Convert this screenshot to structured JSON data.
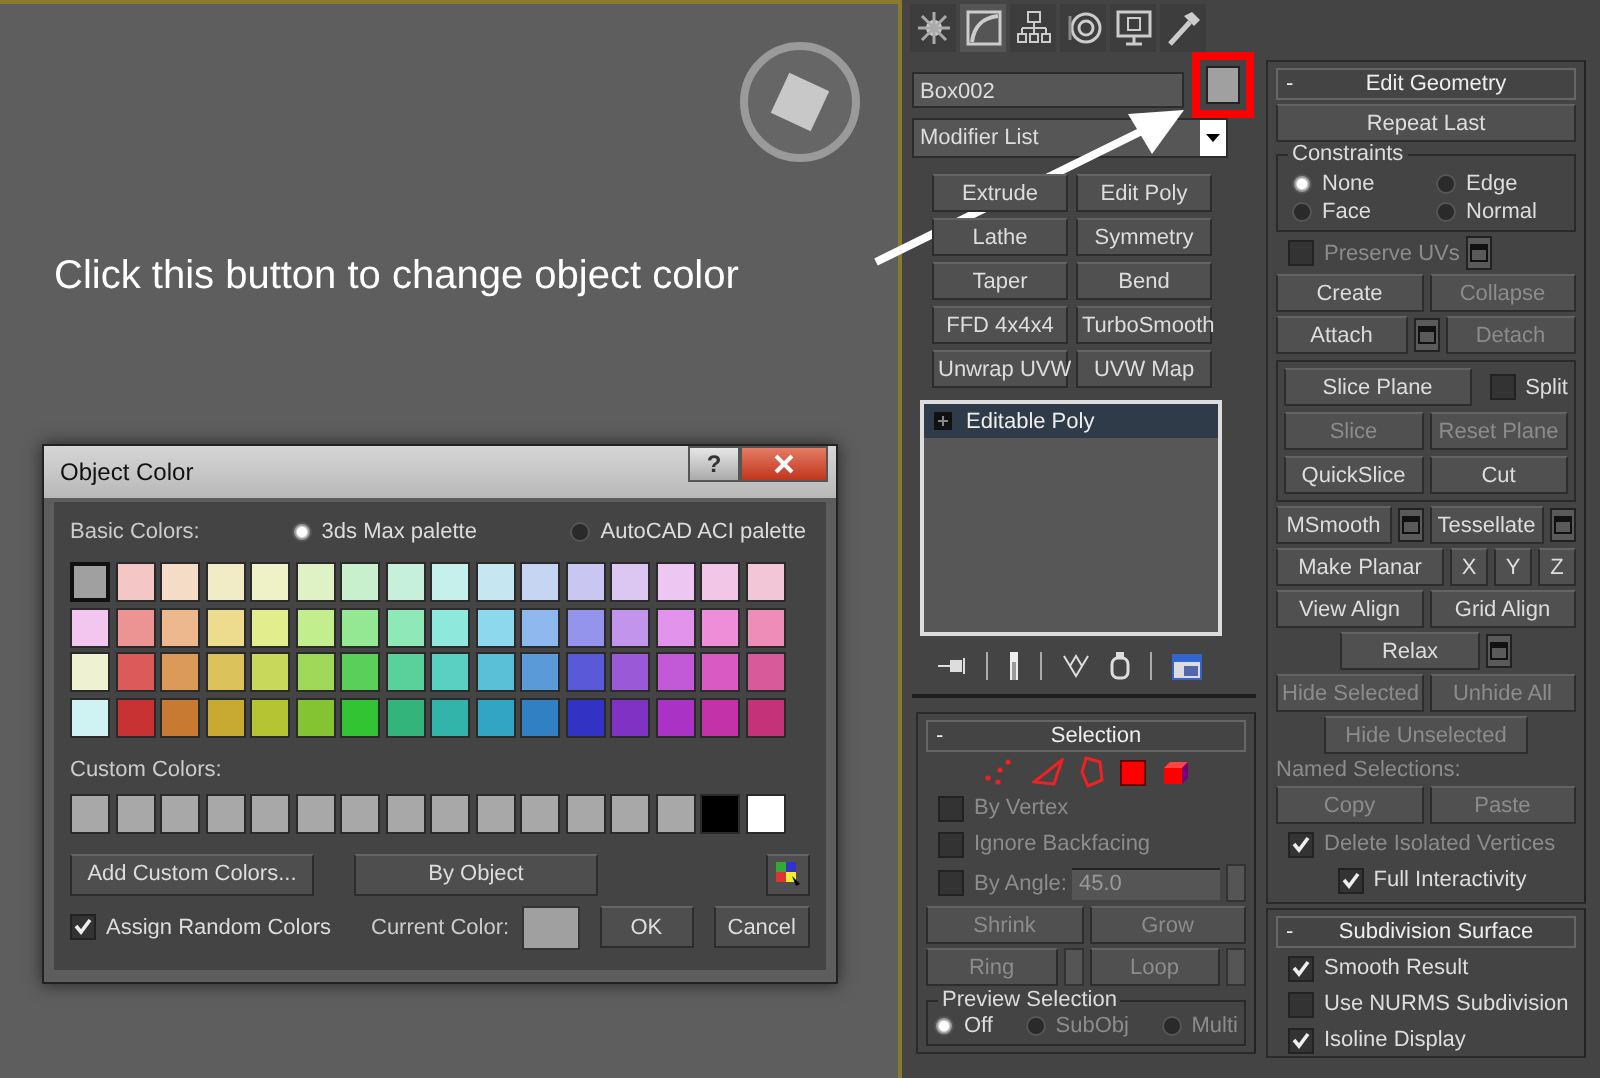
{
  "viewport": {
    "annotation": "Click this button to change object color"
  },
  "dialog": {
    "title": "Object Color",
    "help_button": "?",
    "basic_colors_label": "Basic Colors:",
    "palettes": [
      {
        "label": "3ds Max palette",
        "selected": true
      },
      {
        "label": "AutoCAD ACI palette",
        "selected": false
      }
    ],
    "basic_colors": [
      {
        "color": "#a0a0a0",
        "selected": true
      },
      {
        "color": "#f4c6c6",
        "selected": false
      },
      {
        "color": "#f4dcc6",
        "selected": false
      },
      {
        "color": "#f2ecc6",
        "selected": false
      },
      {
        "color": "#eef2c6",
        "selected": false
      },
      {
        "color": "#dff2c6",
        "selected": false
      },
      {
        "color": "#c9f0cc",
        "selected": false
      },
      {
        "color": "#c6f0dc",
        "selected": false
      },
      {
        "color": "#c6f0ec",
        "selected": false
      },
      {
        "color": "#c6e6f2",
        "selected": false
      },
      {
        "color": "#c6d6f2",
        "selected": false
      },
      {
        "color": "#cac6f2",
        "selected": false
      },
      {
        "color": "#dcc6f2",
        "selected": false
      },
      {
        "color": "#eec6f2",
        "selected": false
      },
      {
        "color": "#f2c6e6",
        "selected": false
      },
      {
        "color": "#f2c6d6",
        "selected": false
      },
      {
        "color": "#f2c6ee",
        "selected": false
      },
      {
        "color": "#ec9494",
        "selected": false
      },
      {
        "color": "#eeb88e",
        "selected": false
      },
      {
        "color": "#eedc8e",
        "selected": false
      },
      {
        "color": "#e2ee8e",
        "selected": false
      },
      {
        "color": "#c2ee8e",
        "selected": false
      },
      {
        "color": "#94e894",
        "selected": false
      },
      {
        "color": "#8ee8b8",
        "selected": false
      },
      {
        "color": "#8ee8dc",
        "selected": false
      },
      {
        "color": "#8ed8ee",
        "selected": false
      },
      {
        "color": "#8eb8ee",
        "selected": false
      },
      {
        "color": "#9494ec",
        "selected": false
      },
      {
        "color": "#c294ec",
        "selected": false
      },
      {
        "color": "#e294ec",
        "selected": false
      },
      {
        "color": "#ee8ed8",
        "selected": false
      },
      {
        "color": "#ee8eb8",
        "selected": false
      },
      {
        "color": "#eef2d2",
        "selected": false
      },
      {
        "color": "#dc5a5a",
        "selected": false
      },
      {
        "color": "#dc9a5a",
        "selected": false
      },
      {
        "color": "#dcc25a",
        "selected": false
      },
      {
        "color": "#c8d85a",
        "selected": false
      },
      {
        "color": "#a0d85a",
        "selected": false
      },
      {
        "color": "#5ad05a",
        "selected": false
      },
      {
        "color": "#5ad09a",
        "selected": false
      },
      {
        "color": "#5ad0c2",
        "selected": false
      },
      {
        "color": "#5ac0d8",
        "selected": false
      },
      {
        "color": "#5a9ad8",
        "selected": false
      },
      {
        "color": "#5a5ad8",
        "selected": false
      },
      {
        "color": "#9a5ad8",
        "selected": false
      },
      {
        "color": "#c25ad8",
        "selected": false
      },
      {
        "color": "#d85ac2",
        "selected": false
      },
      {
        "color": "#d85a9a",
        "selected": false
      },
      {
        "color": "#cff2f2",
        "selected": false
      },
      {
        "color": "#c83232",
        "selected": false
      },
      {
        "color": "#c87a32",
        "selected": false
      },
      {
        "color": "#c8aa32",
        "selected": false
      },
      {
        "color": "#b4c432",
        "selected": false
      },
      {
        "color": "#84c432",
        "selected": false
      },
      {
        "color": "#32c432",
        "selected": false
      },
      {
        "color": "#32b47a",
        "selected": false
      },
      {
        "color": "#32b4aa",
        "selected": false
      },
      {
        "color": "#32a4c4",
        "selected": false
      },
      {
        "color": "#3280c4",
        "selected": false
      },
      {
        "color": "#3232c4",
        "selected": false
      },
      {
        "color": "#8032c4",
        "selected": false
      },
      {
        "color": "#aa32c4",
        "selected": false
      },
      {
        "color": "#c432aa",
        "selected": false
      },
      {
        "color": "#c4327a",
        "selected": false
      }
    ],
    "custom_colors_label": "Custom Colors:",
    "custom_colors": [
      {
        "color": "#a8a8a8"
      },
      {
        "color": "#a8a8a8"
      },
      {
        "color": "#a8a8a8"
      },
      {
        "color": "#a8a8a8"
      },
      {
        "color": "#a8a8a8"
      },
      {
        "color": "#a8a8a8"
      },
      {
        "color": "#a8a8a8"
      },
      {
        "color": "#a8a8a8"
      },
      {
        "color": "#a8a8a8"
      },
      {
        "color": "#a8a8a8"
      },
      {
        "color": "#a8a8a8"
      },
      {
        "color": "#a8a8a8"
      },
      {
        "color": "#a8a8a8"
      },
      {
        "color": "#a8a8a8"
      },
      {
        "color": "#000000"
      },
      {
        "color": "#ffffff"
      }
    ],
    "add_custom_button": "Add Custom Colors...",
    "by_object_button": "By Object",
    "assign_random": {
      "label": "Assign Random Colors",
      "checked": true
    },
    "current_color_label": "Current Color:",
    "buttons": [
      "OK",
      "Cancel"
    ]
  },
  "command_panel": {
    "tabs": [
      {
        "selected": false
      },
      {
        "selected": true
      },
      {
        "selected": false
      },
      {
        "selected": false
      },
      {
        "selected": false
      },
      {
        "selected": false
      }
    ],
    "object_name": "Box002",
    "object_color_highlighted": true,
    "modifier_list": "Modifier List",
    "modifier_buttons": [
      "Extrude",
      "Edit Poly",
      "Lathe",
      "Symmetry",
      "Taper",
      "Bend",
      "FFD 4x4x4",
      "TurboSmooth",
      "Unwrap UVW",
      "UVW Map"
    ],
    "modifier_stack": [
      {
        "label": "Editable Poly",
        "selected": true
      }
    ],
    "selection": {
      "toggle": "-",
      "title": "Selection",
      "checkboxes": [
        {
          "label": "By Vertex",
          "checked": false,
          "disabled": true
        },
        {
          "label": "Ignore Backfacing",
          "checked": false,
          "disabled": true
        },
        {
          "label": "By Angle:",
          "checked": false,
          "disabled": true
        }
      ],
      "angle_value": "45.0",
      "buttons": [
        {
          "label": "Shrink",
          "disabled": true
        },
        {
          "label": "Grow",
          "disabled": true
        },
        {
          "label": "Ring",
          "disabled": true
        },
        {
          "label": "Loop",
          "disabled": true
        }
      ],
      "preview": {
        "title": "Preview Selection",
        "options": [
          {
            "label": "Off",
            "selected": true,
            "disabled": false
          },
          {
            "label": "SubObj",
            "selected": false,
            "disabled": true
          },
          {
            "label": "Multi",
            "selected": false,
            "disabled": true
          }
        ]
      }
    },
    "edit_geometry": {
      "toggle": "-",
      "title": "Edit Geometry",
      "repeat_last": "Repeat Last",
      "constraints": {
        "title": "Constraints",
        "options": [
          {
            "label": "None",
            "selected": true
          },
          {
            "label": "Edge",
            "selected": false
          },
          {
            "label": "Face",
            "selected": false
          },
          {
            "label": "Normal",
            "selected": false
          }
        ]
      },
      "content": [
        {
          "kind": "row",
          "items": [
            {
              "kind": "checkbox",
              "label": "Preserve UVs",
              "checked": false,
              "disabled": true
            },
            {
              "kind": "settings"
            }
          ]
        },
        {
          "kind": "row",
          "items": [
            {
              "kind": "button",
              "label": "Create",
              "disabled": false
            },
            {
              "kind": "button",
              "label": "Collapse",
              "disabled": true
            }
          ]
        },
        {
          "kind": "row",
          "items": [
            {
              "kind": "button",
              "label": "Attach",
              "disabled": false
            },
            {
              "kind": "settings"
            },
            {
              "kind": "button",
              "label": "Detach",
              "disabled": true
            }
          ]
        },
        {
          "kind": "group",
          "rows": [
            [
              {
                "kind": "button",
                "label": "Slice Plane",
                "disabled": false
              },
              {
                "kind": "checkbox",
                "label": "Split",
                "checked": false,
                "disabled": false
              }
            ],
            [
              {
                "kind": "button",
                "label": "Slice",
                "disabled": true
              },
              {
                "kind": "button",
                "label": "Reset Plane",
                "disabled": true
              }
            ],
            [
              {
                "kind": "button",
                "label": "QuickSlice",
                "disabled": false
              },
              {
                "kind": "button",
                "label": "Cut",
                "disabled": false
              }
            ]
          ]
        },
        {
          "kind": "row",
          "items": [
            {
              "kind": "button",
              "label": "MSmooth",
              "disabled": false
            },
            {
              "kind": "settings"
            },
            {
              "kind": "button",
              "label": "Tessellate",
              "disabled": false
            },
            {
              "kind": "settings"
            }
          ]
        },
        {
          "kind": "row",
          "items": [
            {
              "kind": "button",
              "label": "Make Planar",
              "disabled": false
            },
            {
              "kind": "axis",
              "label": "X"
            },
            {
              "kind": "axis",
              "label": "Y"
            },
            {
              "kind": "axis",
              "label": "Z"
            }
          ]
        },
        {
          "kind": "row",
          "items": [
            {
              "kind": "button",
              "label": "View Align",
              "disabled": false
            },
            {
              "kind": "button",
              "label": "Grid Align",
              "disabled": false
            }
          ]
        },
        {
          "kind": "row",
          "items": [
            {
              "kind": "button",
              "label": "Relax",
              "disabled": false
            },
            {
              "kind": "settings"
            }
          ]
        },
        {
          "kind": "row",
          "items": [
            {
              "kind": "button",
              "label": "Hide Selected",
              "disabled": true
            },
            {
              "kind": "button",
              "label": "Unhide All",
              "disabled": true
            }
          ]
        },
        {
          "kind": "row",
          "items": [
            {
              "kind": "button",
              "label": "Hide Unselected",
              "disabled": true
            }
          ]
        },
        {
          "kind": "label",
          "text": "Named Selections:"
        },
        {
          "kind": "row",
          "items": [
            {
              "kind": "button",
              "label": "Copy",
              "disabled": true
            },
            {
              "kind": "button",
              "label": "Paste",
              "disabled": true
            }
          ]
        },
        {
          "kind": "row",
          "items": [
            {
              "kind": "checkbox",
              "label": "Delete Isolated Vertices",
              "checked": true,
              "disabled": true
            }
          ]
        },
        {
          "kind": "row",
          "items": [
            {
              "kind": "checkbox",
              "label": "Full Interactivity",
              "checked": true,
              "disabled": false
            }
          ]
        }
      ]
    },
    "subdivision": {
      "toggle": "-",
      "title": "Subdivision Surface",
      "checkboxes": [
        {
          "label": "Smooth Result",
          "checked": true
        },
        {
          "label": "Use NURMS Subdivision",
          "checked": false
        },
        {
          "label": "Isoline Display",
          "checked": true
        }
      ]
    }
  }
}
